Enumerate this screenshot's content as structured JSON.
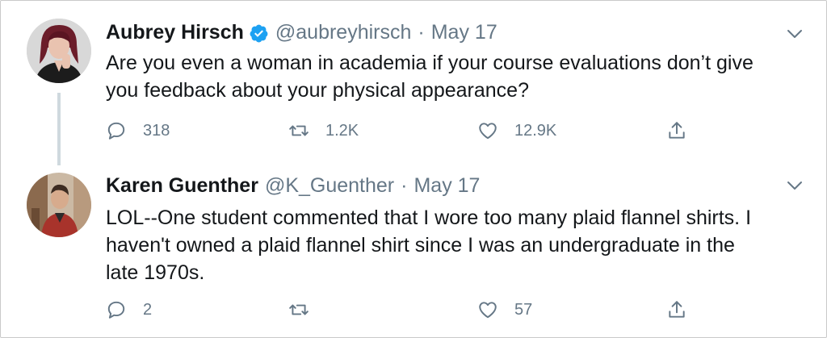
{
  "tweets": [
    {
      "author": {
        "name": "Aubrey Hirsch",
        "verified": true,
        "handle": "@aubreyhirsch",
        "date": "May 17",
        "avatar": "profile-photo-woman-dark-hair"
      },
      "text_lines": [
        "Are you even a woman in academia if your course evaluations don’t give",
        "you feedback about your physical appearance?"
      ],
      "actions": {
        "reply_count": "318",
        "retweet_count": "1.2K",
        "like_count": "12.9K"
      }
    },
    {
      "author": {
        "name": "Karen Guenther",
        "verified": false,
        "handle": "@K_Guenther",
        "date": "May 17",
        "avatar": "profile-photo-person-red-jacket"
      },
      "text_lines": [
        "LOL--One student commented that I wore too many plaid flannel shirts.  I",
        "haven't owned a plaid flannel shirt since I was an undergraduate in the",
        "late 1970s."
      ],
      "actions": {
        "reply_count": "2",
        "retweet_count": "",
        "like_count": "57"
      }
    }
  ],
  "separator_dot": "·",
  "colors": {
    "text_primary": "#14171a",
    "text_secondary": "#657786",
    "verified_blue": "#1da1f2",
    "thread_line": "#cfd9de"
  },
  "icons": [
    "reply-icon",
    "retweet-icon",
    "like-icon",
    "share-icon",
    "chevron-down-icon",
    "verified-badge-icon"
  ]
}
